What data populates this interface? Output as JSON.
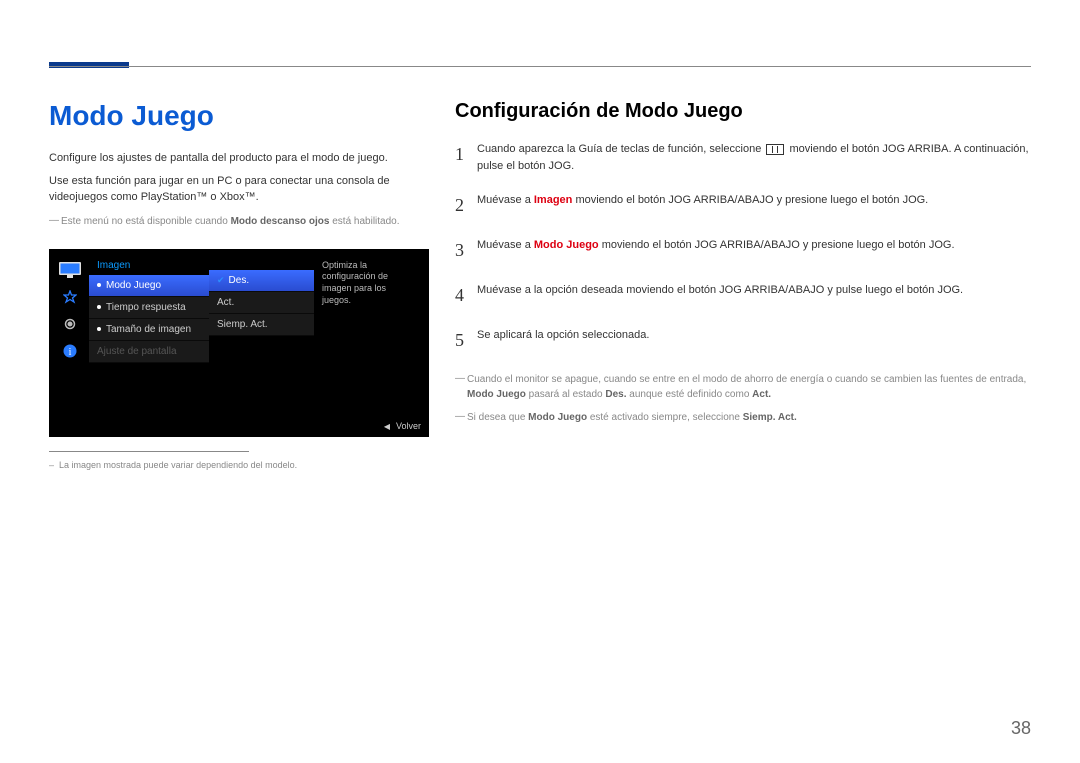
{
  "page_number": "38",
  "left": {
    "heading": "Modo Juego",
    "para1": "Configure los ajustes de pantalla del producto para el modo de juego.",
    "para2": "Use esta función para jugar en un PC o para conectar una consola de videojuegos como PlayStation™ o Xbox™.",
    "note1_pre": "Este menú no está disponible cuando ",
    "note1_bold": "Modo descanso ojos",
    "note1_post": " está habilitado.",
    "caption": "La imagen mostrada puede variar dependiendo del modelo."
  },
  "osd": {
    "category": "Imagen",
    "items": [
      "Modo Juego",
      "Tiempo respuesta",
      "Tamaño de imagen",
      "Ajuste de pantalla"
    ],
    "options": [
      "Des.",
      "Act.",
      "Siemp. Act."
    ],
    "desc": "Optimiza la configuración de imagen para los juegos.",
    "back": "Volver"
  },
  "right": {
    "heading": "Configuración de Modo Juego",
    "steps": [
      {
        "n": "1",
        "pre": "Cuando aparezca la Guía de teclas de función, seleccione ",
        "post": " moviendo el botón JOG ARRIBA. A continuación, pulse el botón JOG."
      },
      {
        "n": "2",
        "pre": "Muévase a ",
        "hl": "Imagen",
        "post": " moviendo el botón JOG ARRIBA/ABAJO y presione luego el botón JOG."
      },
      {
        "n": "3",
        "pre": "Muévase a ",
        "hl": "Modo Juego",
        "post": " moviendo el botón JOG ARRIBA/ABAJO y presione luego el botón JOG."
      },
      {
        "n": "4",
        "text": "Muévase a la opción deseada moviendo el botón JOG ARRIBA/ABAJO y pulse luego el botón JOG."
      },
      {
        "n": "5",
        "text": "Se aplicará la opción seleccionada."
      }
    ],
    "note2_a": "Cuando el monitor se apague, cuando se entre en el modo de ahorro de energía o cuando se cambien las fuentes de entrada, ",
    "note2_b": "Modo Juego",
    "note2_c": " pasará al estado ",
    "note2_d": "Des.",
    "note2_e": " aunque esté definido como ",
    "note2_f": "Act.",
    "note3_a": "Si desea que ",
    "note3_b": "Modo Juego",
    "note3_c": " esté activado siempre, seleccione ",
    "note3_d": "Siemp. Act."
  }
}
